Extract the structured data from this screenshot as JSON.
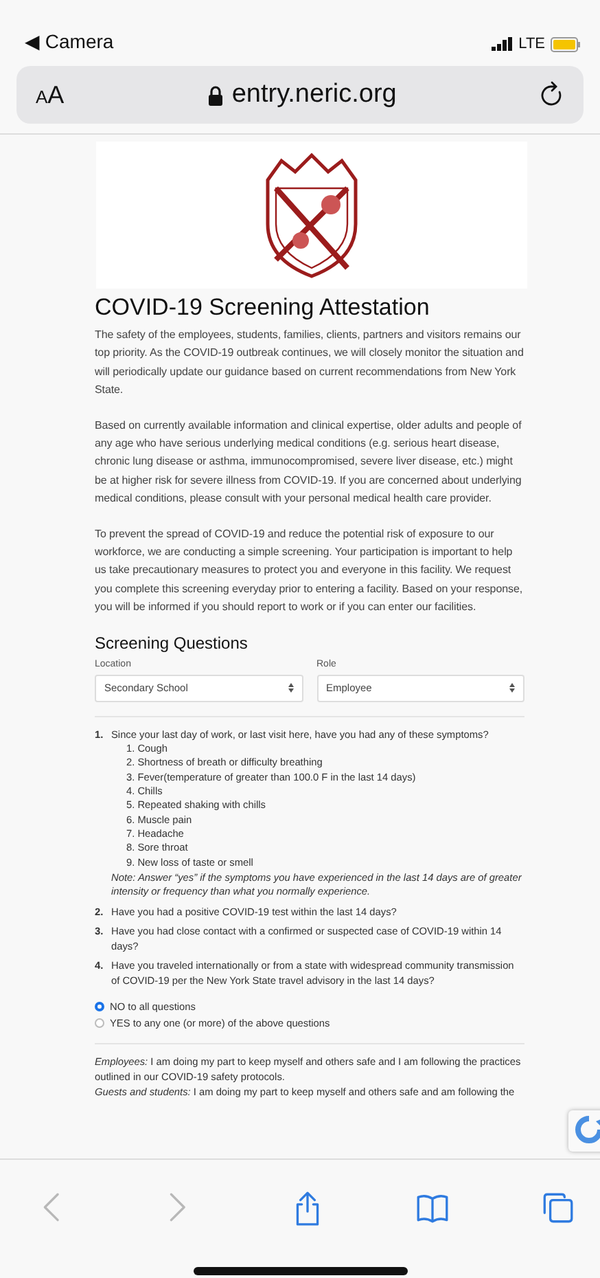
{
  "status_bar": {
    "back_label": "◀ Camera",
    "network": "LTE"
  },
  "address_bar": {
    "text_size_button": "AA",
    "url": "entry.neric.org"
  },
  "page": {
    "heading": "COVID-19 Screening Attestation",
    "paragraphs": [
      "The safety of the employees, students, families, clients, partners and visitors remains our top priority. As the COVID-19 outbreak continues, we will closely monitor the situation and will periodically update our guidance based on current recommendations from New York State.",
      "Based on currently available information and clinical expertise, older adults and people of any age who have serious underlying medical conditions (e.g. serious heart disease, chronic lung disease or asthma, immunocompromised, severe liver disease, etc.) might be at higher risk for severe illness from COVID-19. If you are concerned about underlying medical conditions, please consult with your personal medical health care provider.",
      "To prevent the spread of COVID-19 and reduce the potential risk of exposure to our workforce, we are conducting a simple screening. Your participation is important to help us take precautionary measures to protect you and everyone in this facility. We request you complete this screening everyday prior to entering a facility. Based on your response, you will be informed if you should report to work or if you can enter our facilities."
    ],
    "section_heading": "Screening Questions",
    "fields": [
      {
        "label": "Location",
        "value": "Secondary School"
      },
      {
        "label": "Role",
        "value": "Employee"
      }
    ],
    "questions": [
      {
        "number": "1.",
        "text": "Since your last day of work, or last visit here, have you had any of these symptoms?",
        "symptoms": [
          "1. Cough",
          "2. Shortness of breath or difficulty breathing",
          "3. Fever(temperature of greater than 100.0 F in the last 14 days)",
          "4. Chills",
          "5. Repeated shaking with chills",
          "6. Muscle pain",
          "7. Headache",
          "8. Sore throat",
          "9. New loss of taste or smell"
        ],
        "note": "Note: Answer “yes” if the symptoms you have experienced in the last 14 days are of greater intensity or frequency than what you normally experience."
      },
      {
        "number": "2.",
        "text": "Have you had a positive COVID-19 test within the last 14 days?"
      },
      {
        "number": "3.",
        "text": "Have you had close contact with a confirmed or suspected case of COVID-19 within 14 days?"
      },
      {
        "number": "4.",
        "text": "Have you traveled internationally or from a state with widespread community transmission of COVID-19 per the New York State travel advisory in the last 14 days?"
      }
    ],
    "answers": [
      {
        "label": "NO to all questions",
        "selected": true
      },
      {
        "label": "YES to any one (or more) of the above questions",
        "selected": false
      }
    ],
    "attestations": [
      "*Employees:* I am doing my part to keep myself and others safe and I am following the practices outlined in our COVID-19 safety protocols.",
      "*Guests and students:* I am doing my part to keep myself and others safe and am following the"
    ]
  },
  "toolbar": [
    {
      "kind": "back",
      "disabled": true
    },
    {
      "kind": "forward",
      "disabled": true
    },
    {
      "kind": "share",
      "disabled": false
    },
    {
      "kind": "bookmarks",
      "disabled": false
    },
    {
      "kind": "tabs",
      "disabled": false
    }
  ]
}
